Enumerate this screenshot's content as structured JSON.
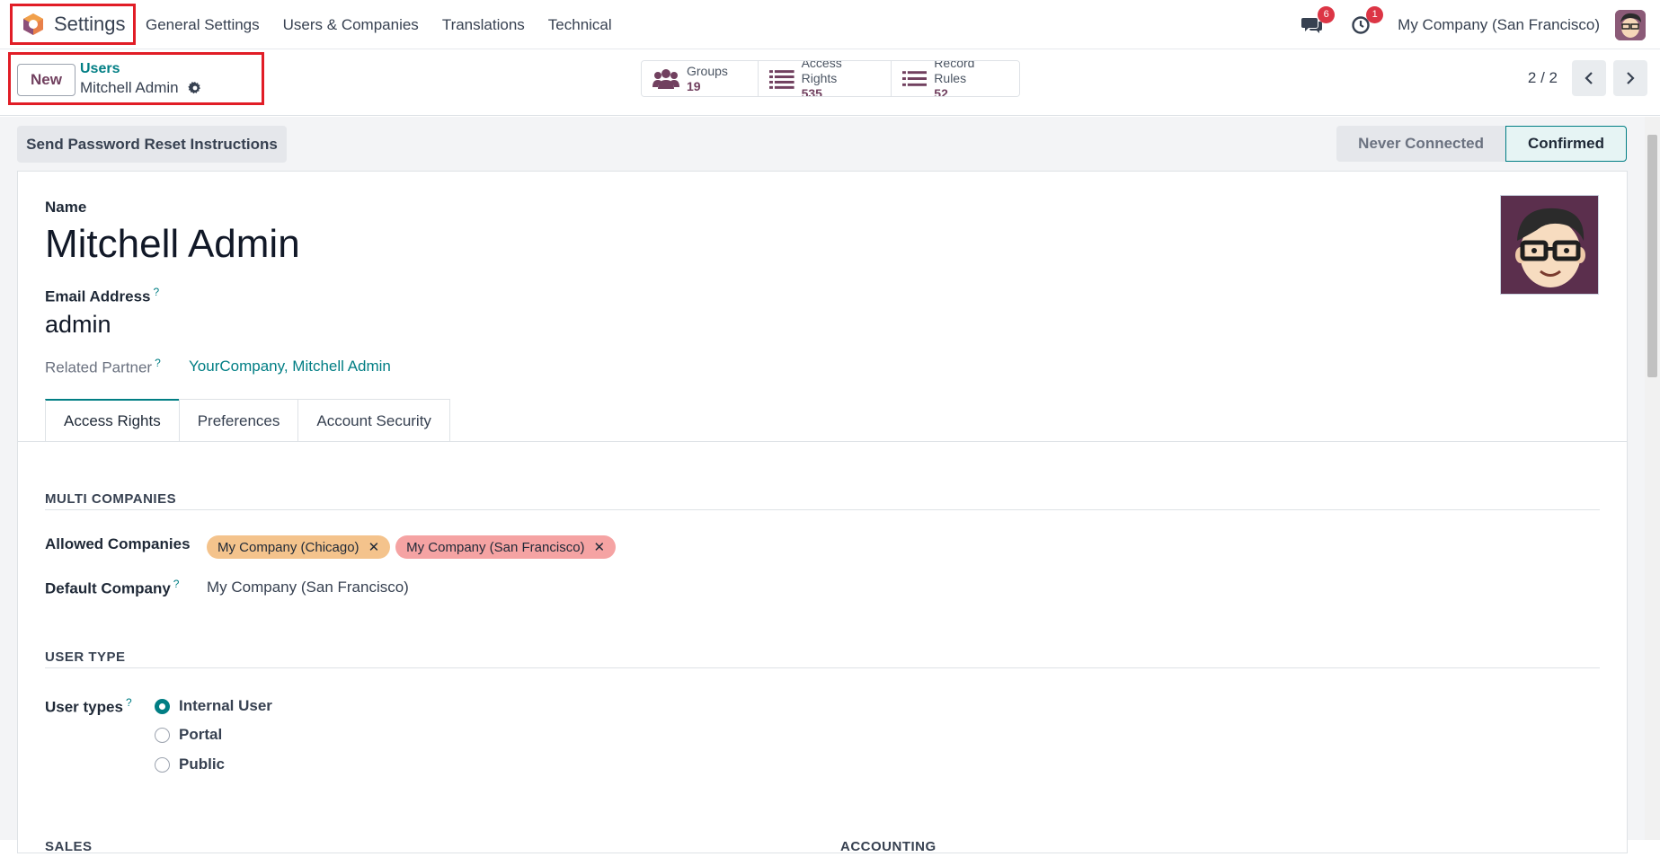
{
  "navbar": {
    "app_title": "Settings",
    "menu": [
      "General Settings",
      "Users & Companies",
      "Translations",
      "Technical"
    ],
    "messages_badge": "6",
    "activities_badge": "1",
    "company": "My Company (San Francisco)",
    "accent_color": "#71405f"
  },
  "control_panel": {
    "new_label": "New",
    "breadcrumb_parent": "Users",
    "breadcrumb_current": "Mitchell Admin",
    "smart_buttons": [
      {
        "label": "Groups",
        "value": "19",
        "icon": "users-icon"
      },
      {
        "label": "Access Rights",
        "value": "535",
        "icon": "list-icon"
      },
      {
        "label": "Record Rules",
        "value": "52",
        "icon": "list-icon"
      }
    ],
    "pager": "2 / 2"
  },
  "form": {
    "reset_button": "Send Password Reset Instructions",
    "status": {
      "inactive": "Never Connected",
      "active": "Confirmed"
    },
    "name_label": "Name",
    "name_value": "Mitchell Admin",
    "email_label": "Email Address",
    "email_value": "admin",
    "partner_label": "Related Partner",
    "partner_value": "YourCompany, Mitchell Admin",
    "help_mark": "?",
    "tabs": [
      "Access Rights",
      "Preferences",
      "Account Security"
    ],
    "multi_companies": {
      "title": "MULTI COMPANIES",
      "allowed_label": "Allowed Companies",
      "allowed": [
        "My Company (Chicago)",
        "My Company (San Francisco)"
      ],
      "default_label": "Default Company",
      "default_value": "My Company (San Francisco)"
    },
    "user_type": {
      "title": "USER TYPE",
      "label": "User types",
      "options": [
        "Internal User",
        "Portal",
        "Public"
      ],
      "selected": "Internal User"
    },
    "lower_sections": [
      "SALES",
      "ACCOUNTING"
    ]
  }
}
